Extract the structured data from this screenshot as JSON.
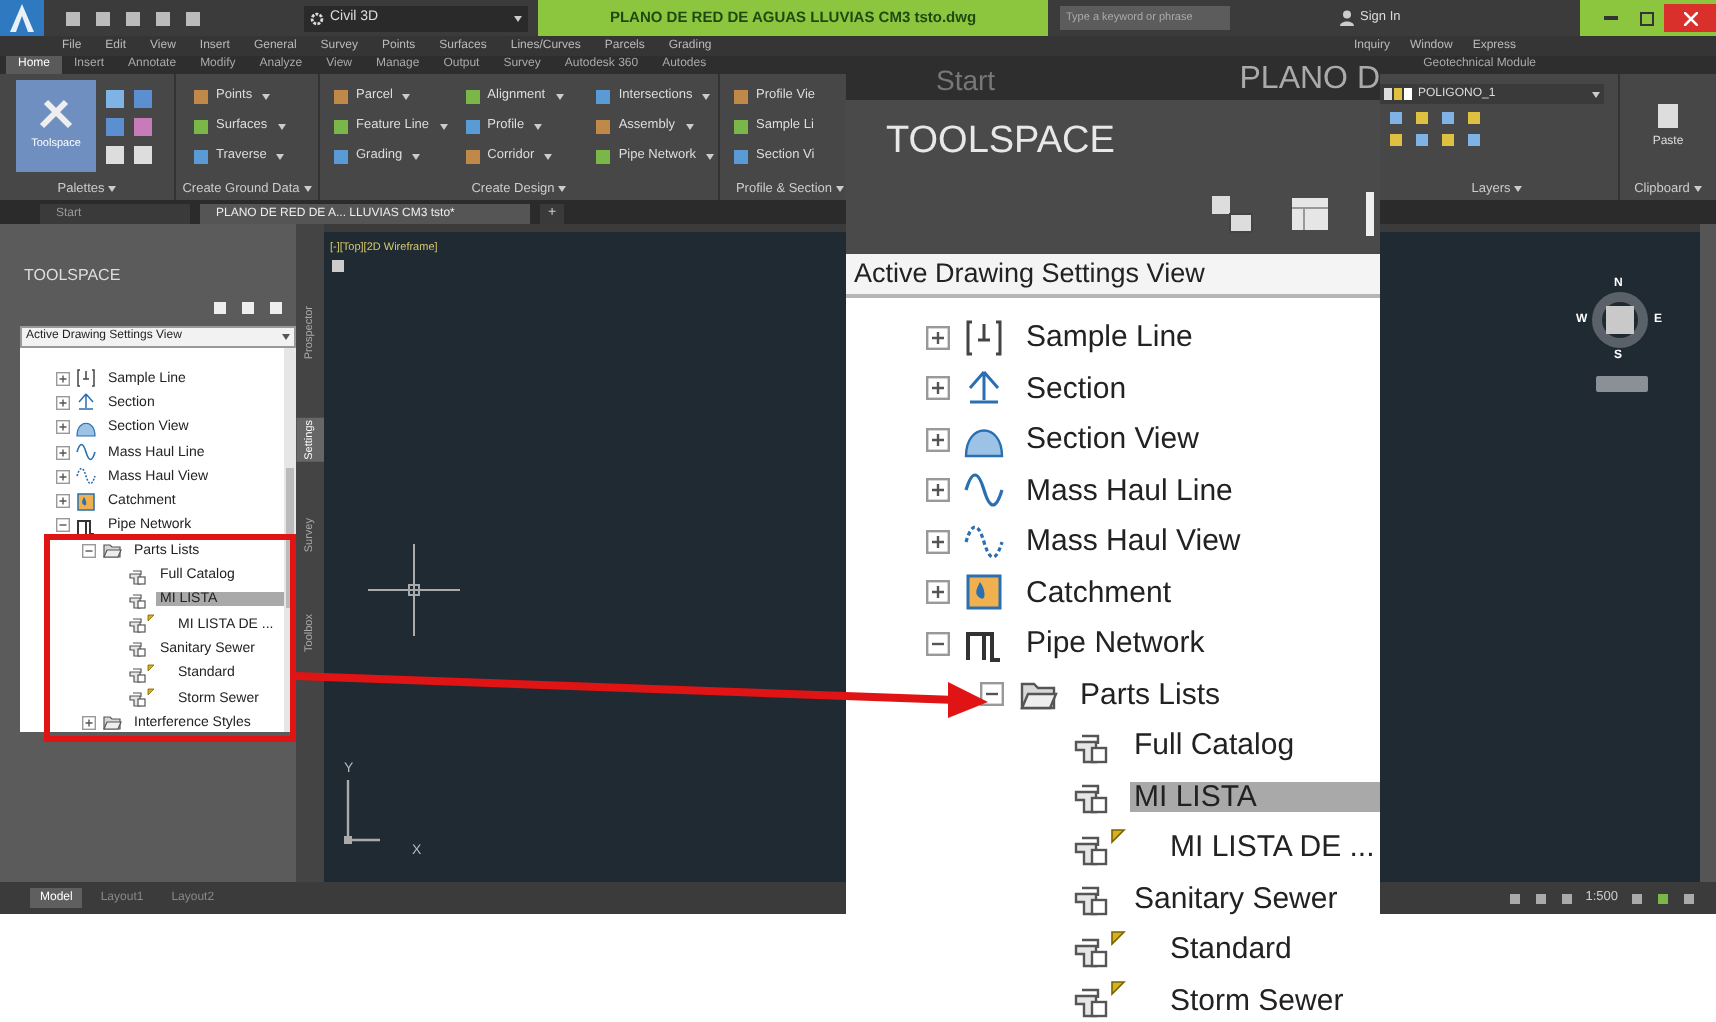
{
  "title_bar": {
    "workspace": "Civil 3D",
    "title": "PLANO DE RED DE AGUAS LLUVIAS CM3 tsto.dwg",
    "search_placeholder": "Type a keyword or phrase",
    "user": "Sign In"
  },
  "menu_bar": {
    "left": [
      "File",
      "Edit",
      "View",
      "Insert",
      "General",
      "Survey",
      "Points",
      "Surfaces",
      "Lines/Curves",
      "Parcels",
      "Grading"
    ],
    "right": [
      "Inquiry",
      "Window",
      "Express"
    ]
  },
  "ribbon_tabs": {
    "tabs": [
      {
        "label": "Home",
        "selected": true
      },
      {
        "label": "Insert",
        "selected": false
      },
      {
        "label": "Annotate",
        "selected": false
      },
      {
        "label": "Modify",
        "selected": false
      },
      {
        "label": "Analyze",
        "selected": false
      },
      {
        "label": "View",
        "selected": false
      },
      {
        "label": "Manage",
        "selected": false
      },
      {
        "label": "Output",
        "selected": false
      },
      {
        "label": "Survey",
        "selected": false
      },
      {
        "label": "Autodesk 360",
        "selected": false
      },
      {
        "label": "Autodes",
        "selected": false
      }
    ],
    "right": "Geotechnical Module"
  },
  "ribbon": {
    "toolspace": "Toolspace",
    "palettes": "Palettes",
    "ground": {
      "title": "Create Ground Data",
      "items": [
        "Points",
        "Surfaces",
        "Traverse"
      ]
    },
    "design": {
      "title": "Create Design",
      "columns": [
        [
          "Parcel",
          "Feature Line",
          "Grading"
        ],
        [
          "Alignment",
          "Profile",
          "Corridor"
        ],
        [
          "Intersections",
          "Assembly",
          "Pipe Network"
        ]
      ]
    },
    "profile_section": {
      "title": "Profile & Section",
      "items": [
        "Profile Vie",
        "Sample Li",
        "Section Vi"
      ]
    },
    "layers": {
      "layer": "POLIGONO_1",
      "title": "Layers"
    },
    "clipboard": {
      "paste": "Paste",
      "title": "Clipboard"
    }
  },
  "doc_tabs": {
    "tabs": [
      {
        "label": "Start",
        "selected": false
      },
      {
        "label": "PLANO DE RED DE A... LLUVIAS CM3 tsto*",
        "selected": true
      }
    ],
    "new_tab": "+"
  },
  "toolspace": {
    "title": "TOOLSPACE",
    "view": "Active Drawing Settings View",
    "tree": [
      {
        "label": "Sample Line",
        "kind": "sample-line",
        "expanded": false,
        "selected": false
      },
      {
        "label": "Section",
        "kind": "section",
        "expanded": false,
        "selected": false
      },
      {
        "label": "Section View",
        "kind": "section-view",
        "expanded": false,
        "selected": false
      },
      {
        "label": "Mass Haul Line",
        "kind": "mass-haul-line",
        "expanded": false,
        "selected": false
      },
      {
        "label": "Mass Haul View",
        "kind": "mass-haul-view",
        "expanded": false,
        "selected": false
      },
      {
        "label": "Catchment",
        "kind": "catchment",
        "expanded": false,
        "selected": false
      },
      {
        "label": "Pipe Network",
        "kind": "pipe-network",
        "expanded": true,
        "selected": false,
        "children": [
          {
            "label": "Parts Lists",
            "kind": "folder",
            "expanded": true,
            "selected": false,
            "children": [
              {
                "label": "Full Catalog",
                "kind": "parts-list",
                "selected": false
              },
              {
                "label": "MI LISTA",
                "kind": "parts-list",
                "selected": true
              },
              {
                "label": "MI LISTA DE ...",
                "kind": "parts-list-flag",
                "selected": false
              },
              {
                "label": "Sanitary Sewer",
                "kind": "parts-list",
                "selected": false
              },
              {
                "label": "Standard",
                "kind": "parts-list-flag",
                "selected": false
              },
              {
                "label": "Storm Sewer",
                "kind": "parts-list-flag",
                "selected": false
              }
            ]
          },
          {
            "label": "Interference Styles",
            "kind": "folder",
            "expanded": false,
            "selected": false
          }
        ]
      }
    ],
    "side_tabs": [
      {
        "label": "Prospector",
        "selected": false
      },
      {
        "label": "Settings",
        "selected": true
      },
      {
        "label": "Survey",
        "selected": false
      },
      {
        "label": "Toolbox",
        "selected": false
      }
    ]
  },
  "viewport": {
    "label": "[-][Top][2D Wireframe]",
    "compass": {
      "north": "N",
      "south": "S",
      "east": "E",
      "west": "W"
    },
    "ucs": {
      "x": "X",
      "y": "Y"
    }
  },
  "layout_tabs": [
    {
      "label": "Model",
      "selected": true
    },
    {
      "label": "Layout1",
      "selected": false
    },
    {
      "label": "Layout2",
      "selected": false
    }
  ],
  "status_bar": {
    "scale": "1:500"
  },
  "callout": {
    "tab": "Start",
    "drawing_title": "PLANO D",
    "title": "TOOLSPACE",
    "view": "Active Drawing Settings View",
    "tree": [
      {
        "label": "Sample Line",
        "kind": "sample-line",
        "expanded": false,
        "selected": false
      },
      {
        "label": "Section",
        "kind": "section",
        "expanded": false,
        "selected": false
      },
      {
        "label": "Section View",
        "kind": "section-view",
        "expanded": false,
        "selected": false
      },
      {
        "label": "Mass Haul Line",
        "kind": "mass-haul-line",
        "expanded": false,
        "selected": false
      },
      {
        "label": "Mass Haul View",
        "kind": "mass-haul-view",
        "expanded": false,
        "selected": false
      },
      {
        "label": "Catchment",
        "kind": "catchment",
        "expanded": false,
        "selected": false
      },
      {
        "label": "Pipe Network",
        "kind": "pipe-network",
        "expanded": true,
        "selected": false,
        "children": [
          {
            "label": "Parts Lists",
            "kind": "folder",
            "expanded": true,
            "selected": false,
            "children": [
              {
                "label": "Full Catalog",
                "kind": "parts-list",
                "selected": false
              },
              {
                "label": "MI LISTA",
                "kind": "parts-list",
                "selected": true
              },
              {
                "label": "MI LISTA DE ...",
                "kind": "parts-list-flag",
                "selected": false
              },
              {
                "label": "Sanitary Sewer",
                "kind": "parts-list",
                "selected": false
              },
              {
                "label": "Standard",
                "kind": "parts-list-flag",
                "selected": false
              },
              {
                "label": "Storm Sewer",
                "kind": "parts-list-flag",
                "selected": false
              }
            ]
          }
        ]
      }
    ]
  }
}
